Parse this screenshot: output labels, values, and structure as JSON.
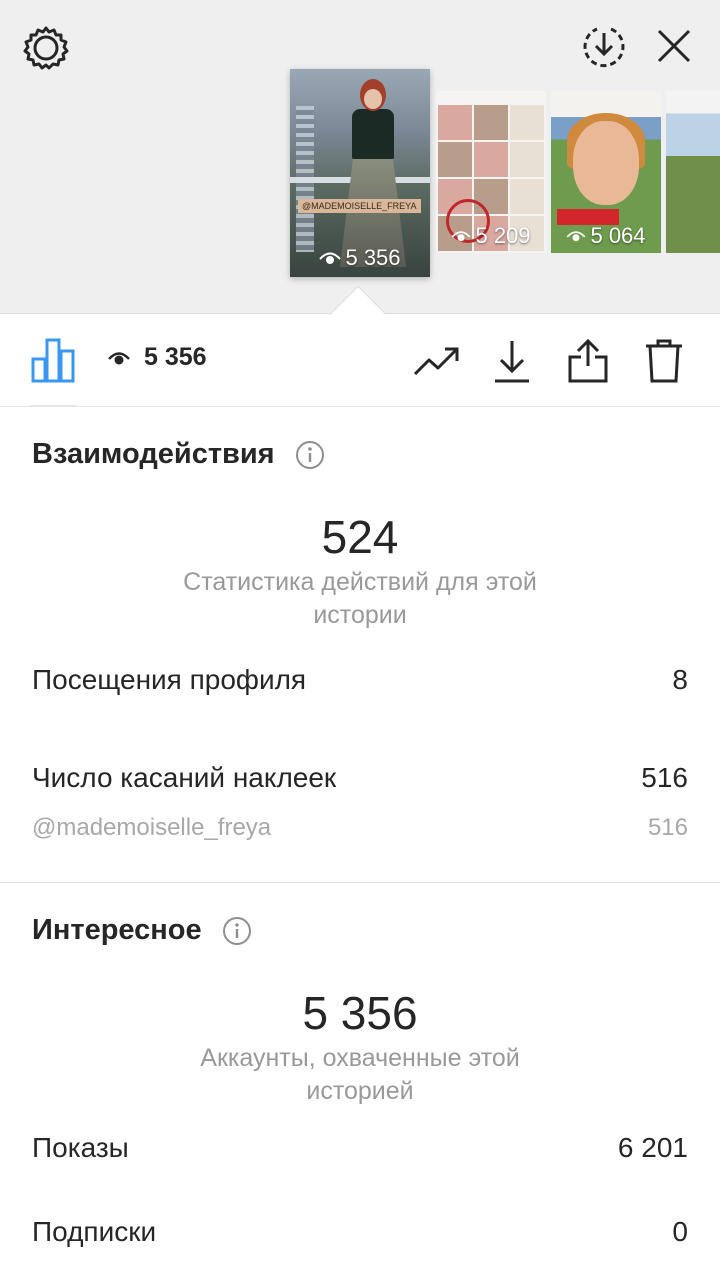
{
  "header": {
    "settings_icon": "gear-icon",
    "download_icon": "download-circle-icon",
    "close_icon": "close-icon"
  },
  "stories": [
    {
      "views": "5 356",
      "tag": "@MADEMOISELLE_FREYA"
    },
    {
      "views": "5 209"
    },
    {
      "views": "5 064"
    },
    {
      "views": ""
    }
  ],
  "tabbar": {
    "views": "5 356",
    "icons": [
      "bar-chart-icon",
      "eye-icon",
      "trending-icon",
      "download-icon",
      "share-icon",
      "trash-icon"
    ],
    "accent_color": "#3897f0"
  },
  "interactions": {
    "title": "Взаимодействия",
    "total": "524",
    "caption": "Статистика действий для этой истории",
    "rows": [
      {
        "label": "Посещения профиля",
        "value": "8"
      },
      {
        "label": "Число касаний наклеек",
        "value": "516"
      },
      {
        "label": "@mademoiselle_freya",
        "value": "516"
      }
    ]
  },
  "discovery": {
    "title": "Интересное",
    "total": "5 356",
    "caption": "Аккаунты, охваченные этой историей",
    "rows": [
      {
        "label": "Показы",
        "value": "6 201"
      },
      {
        "label": "Подписки",
        "value": "0"
      }
    ]
  }
}
